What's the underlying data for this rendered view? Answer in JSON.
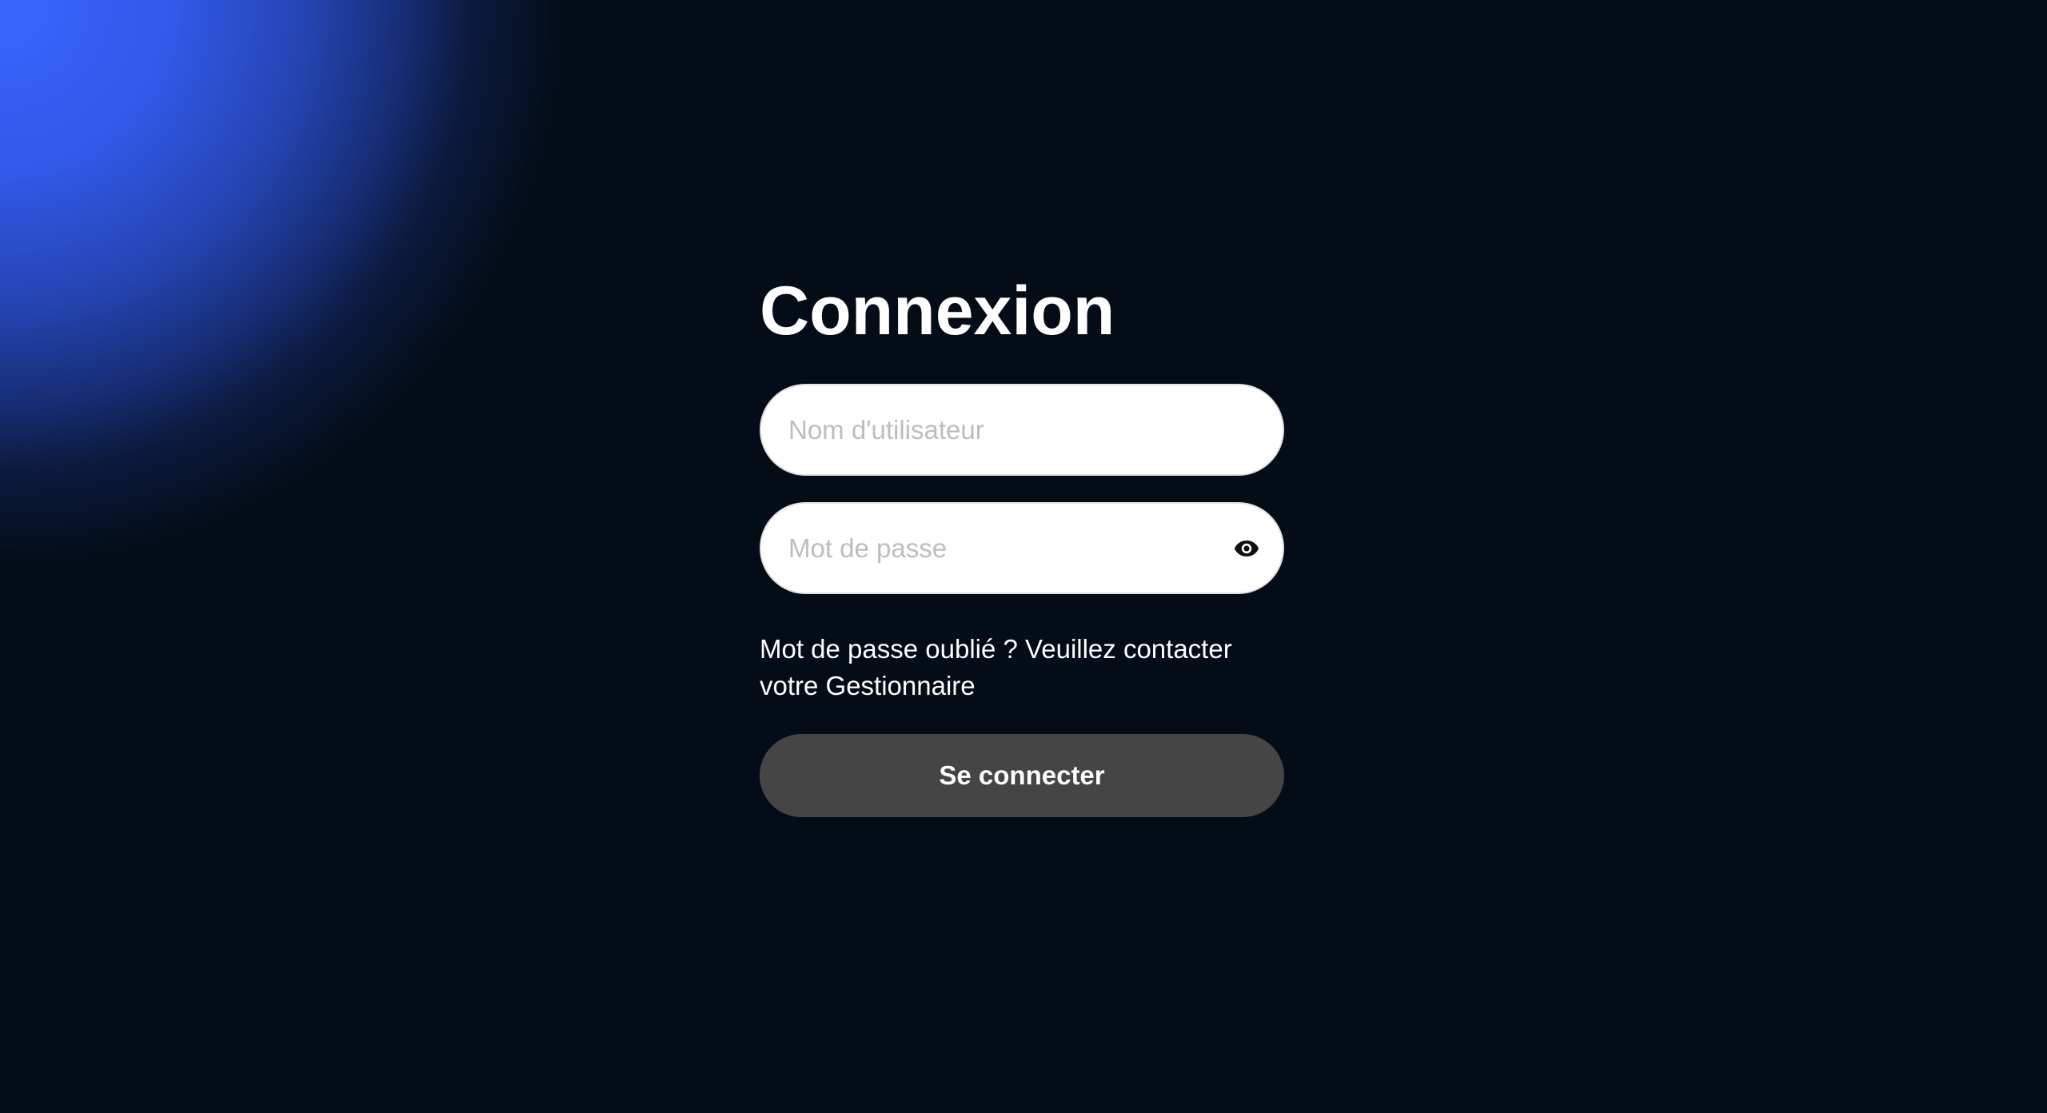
{
  "background": {
    "base_color": "#030c17",
    "glow_color": "#3a66ff"
  },
  "login": {
    "title": "Connexion",
    "username": {
      "value": "",
      "placeholder": "Nom d'utilisateur"
    },
    "password": {
      "value": "",
      "placeholder": "Mot de passe",
      "toggle_icon": "eye-icon"
    },
    "forgot_text": "Mot de passe oublié ? Veuillez contacter votre Gestionnaire",
    "submit_label": "Se connecter",
    "submit_color": "#454545"
  }
}
